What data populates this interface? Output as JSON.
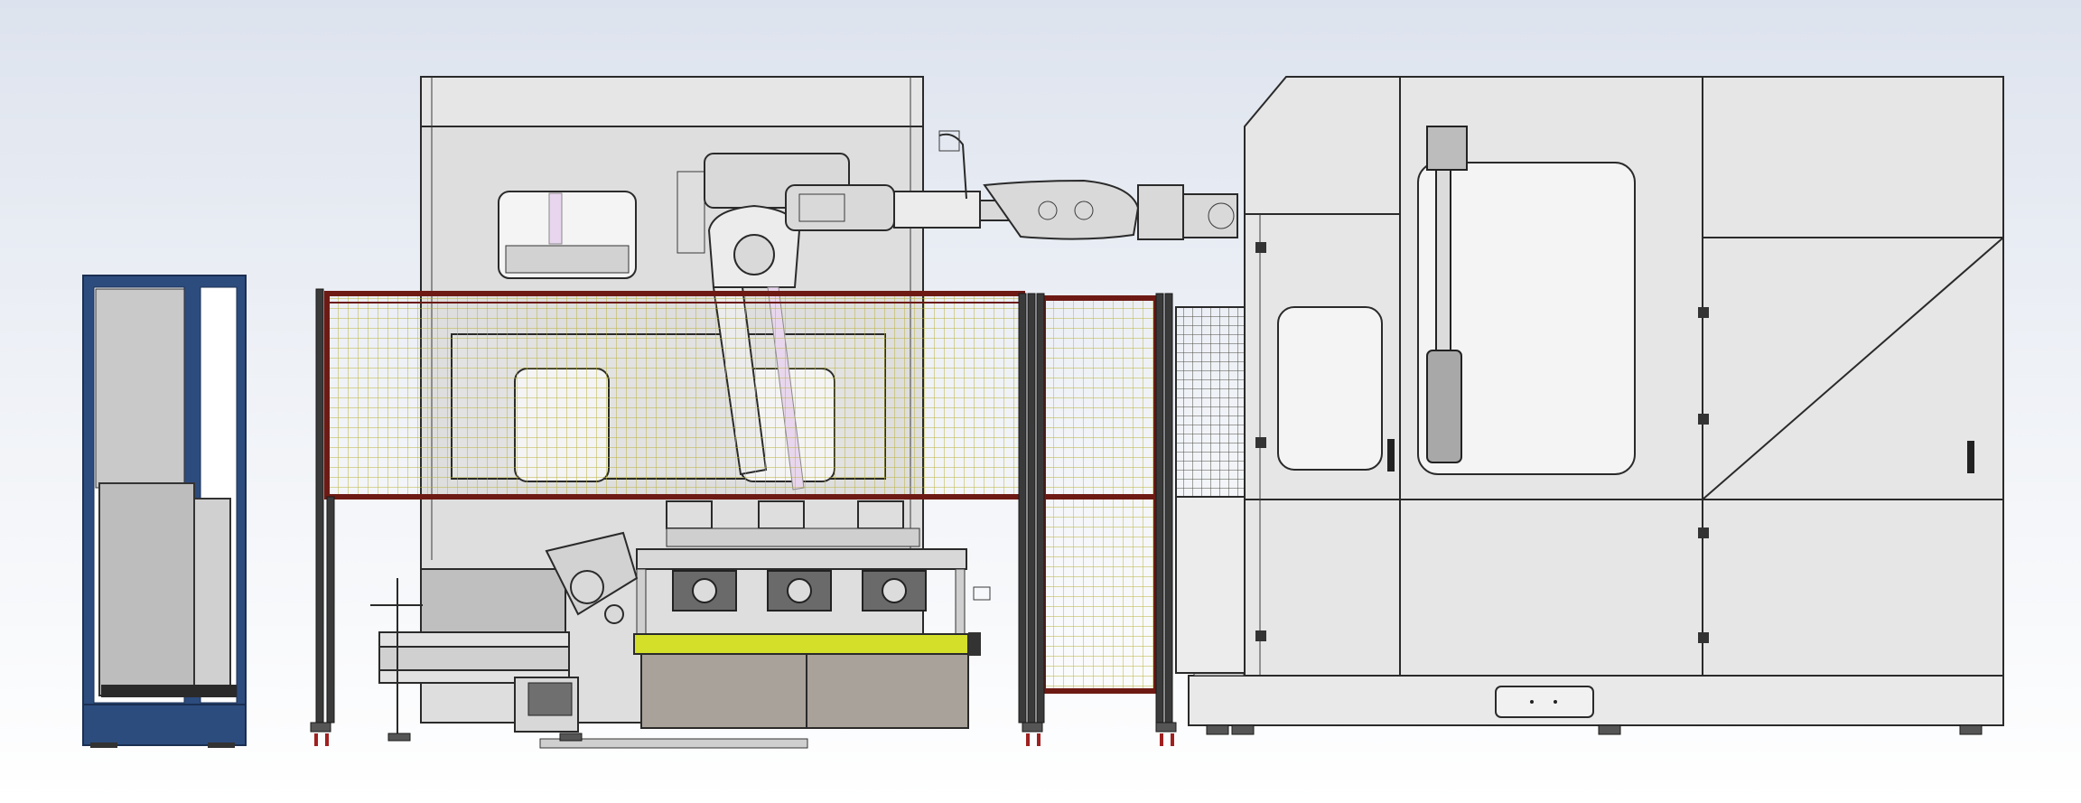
{
  "colors": {
    "background_top": "#dde3ee",
    "cabinet_blue": "#2c4c7e",
    "machine_grey": "#e6e6e6",
    "fence_red": "#6e1a14",
    "mesh_yellow": "#b8b23a",
    "table_yellow": "#d4df2a",
    "table_base": "#a8a29a"
  }
}
